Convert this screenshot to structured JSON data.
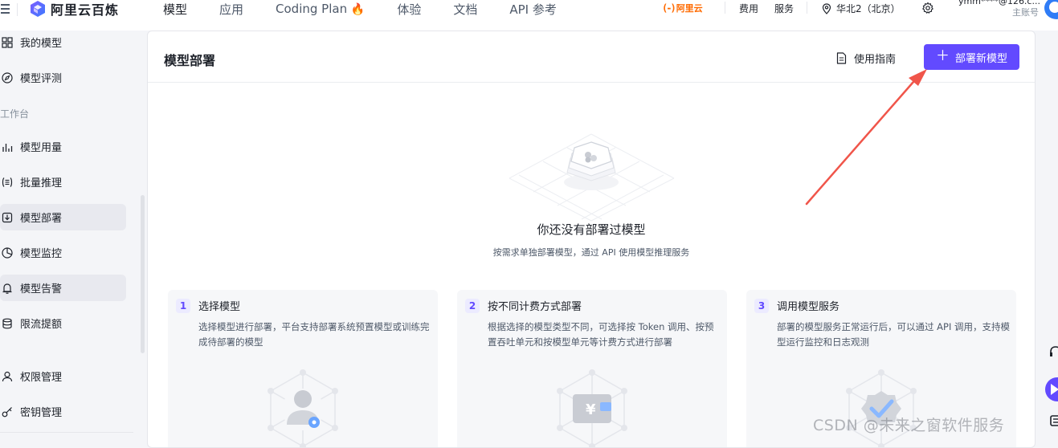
{
  "topbar": {
    "logo_text": "阿里云百炼",
    "nav": [
      {
        "label": "模型"
      },
      {
        "label": "应用"
      },
      {
        "label": "Coding Plan",
        "badge": "🔥"
      },
      {
        "label": "体验"
      },
      {
        "label": "文档"
      },
      {
        "label": "API 参考"
      }
    ],
    "brand_mark": "(-)",
    "brand": "阿里云",
    "fees": "费用",
    "service": "服务",
    "region": "华北2（北京）",
    "account_name": "ymm****@126.c...",
    "account_role": "主账号",
    "colors": {
      "brand_orange": "#ff6a00",
      "accent": "#624aff"
    }
  },
  "sidebar": {
    "items_top": [
      {
        "label": "我的模型",
        "icon": "grid-icon"
      },
      {
        "label": "模型评测",
        "icon": "compass-icon"
      }
    ],
    "group_label": "工作台",
    "items_workbench": [
      {
        "label": "模型用量",
        "icon": "bar-chart-icon"
      },
      {
        "label": "批量推理",
        "icon": "list-brackets-icon"
      },
      {
        "label": "模型部署",
        "icon": "deploy-box-icon",
        "selected": true
      },
      {
        "label": "模型监控",
        "icon": "pie-chart-icon"
      },
      {
        "label": "模型告警",
        "icon": "bell-icon",
        "selected": true
      },
      {
        "label": "限流提额",
        "icon": "database-icon"
      }
    ],
    "items_bottom": [
      {
        "label": "权限管理",
        "icon": "user-icon"
      },
      {
        "label": "密钥管理",
        "icon": "key-icon"
      }
    ]
  },
  "main": {
    "title": "模型部署",
    "guide_label": "使用指南",
    "deploy_button": "部署新模型",
    "empty_title": "你还没有部署过模型",
    "empty_subtitle": "按需求单独部署模型，通过 API 使用模型推理服务",
    "steps": [
      {
        "num": "1",
        "title": "选择模型",
        "desc": "选择模型进行部署，平台支持部署系统预置模型或训练完成待部署的模型"
      },
      {
        "num": "2",
        "title": "按不同计费方式部署",
        "desc": "根据选择的模型类型不同，可选择按 Token 调用、按预置吞吐单元和按模型单元等计费方式进行部署"
      },
      {
        "num": "3",
        "title": "调用模型服务",
        "desc": "部署的模型服务正常运行后，可以通过 API 调用，支持模型运行监控和日志观测"
      }
    ]
  },
  "watermark": "CSDN @未来之窗软件服务"
}
